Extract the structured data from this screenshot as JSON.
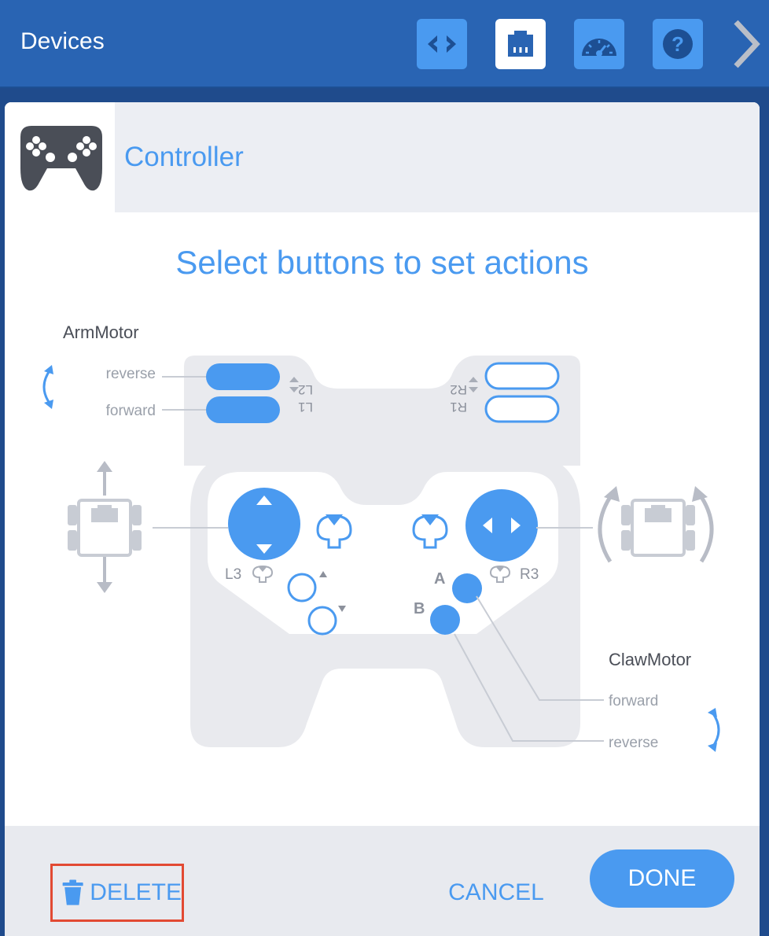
{
  "topbar": {
    "title": "Devices",
    "buttons": [
      {
        "icon": "code-brackets-icon",
        "active": false
      },
      {
        "icon": "device-port-icon",
        "active": true
      },
      {
        "icon": "dashboard-gauge-icon",
        "active": false
      },
      {
        "icon": "help-icon",
        "active": false
      }
    ],
    "next_icon": "chevron-right-icon"
  },
  "device": {
    "icon": "gamepad-controller-icon",
    "name": "Controller"
  },
  "instructions": "Select buttons to set actions",
  "mappings": {
    "arm": {
      "motor": "ArmMotor",
      "reverse_label": "reverse",
      "forward_label": "forward"
    },
    "claw": {
      "motor": "ClawMotor",
      "forward_label": "forward",
      "reverse_label": "reverse"
    }
  },
  "controller_labels": {
    "l2": "L2",
    "l1": "L1",
    "r2": "R2",
    "r1": "R1",
    "l3": "L3",
    "r3": "R3",
    "a": "A",
    "b": "B"
  },
  "footer": {
    "delete_label": "DELETE",
    "cancel_label": "CANCEL",
    "done_label": "DONE"
  },
  "colors": {
    "accent": "#4a9af0",
    "topbar": "#2964b3",
    "highlight_border": "#e24a33",
    "controller_body": "#e9eaee",
    "inactive_gray": "#b8bcc6"
  }
}
